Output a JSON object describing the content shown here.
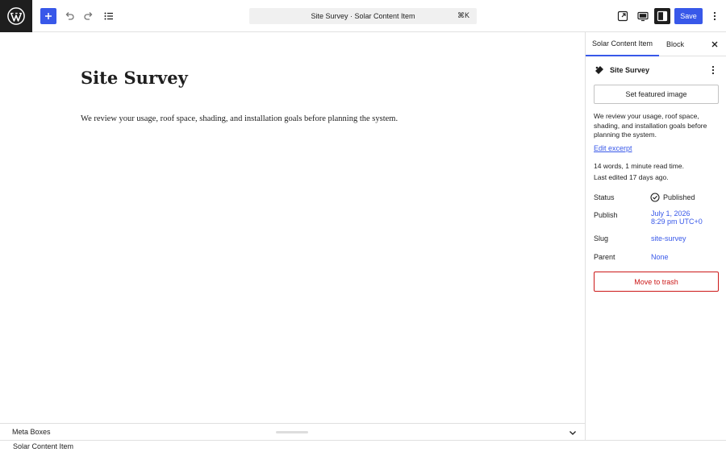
{
  "toolbar": {
    "document_title": "Site Survey · Solar Content Item",
    "shortcut": "⌘K",
    "save_label": "Save"
  },
  "editor": {
    "post_title": "Site Survey",
    "post_body": "We review your usage, roof space, shading, and installation goals before planning the system."
  },
  "meta_boxes": {
    "label": "Meta Boxes"
  },
  "footer": {
    "breadcrumb": "Solar Content Item"
  },
  "sidebar": {
    "tabs": [
      {
        "label": "Solar Content Item",
        "active": true
      },
      {
        "label": "Block",
        "active": false
      }
    ],
    "post_name": "Site Survey",
    "featured_image_label": "Set featured image",
    "excerpt": "We review your usage, roof space, shading, and installation goals before planning the system.",
    "edit_excerpt_label": "Edit excerpt",
    "word_info": "14 words, 1 minute read time.",
    "last_edited": "Last edited 17 days ago.",
    "status": {
      "label": "Status",
      "value": "Published"
    },
    "publish": {
      "label": "Publish",
      "line1": "July 1, 2026",
      "line2": "8:29 pm UTC+0"
    },
    "slug": {
      "label": "Slug",
      "value": "site-survey"
    },
    "parent": {
      "label": "Parent",
      "value": "None"
    },
    "trash_label": "Move to trash"
  },
  "colors": {
    "accent": "#3858e9",
    "danger": "#cc1818",
    "dark": "#1e1e1e"
  }
}
